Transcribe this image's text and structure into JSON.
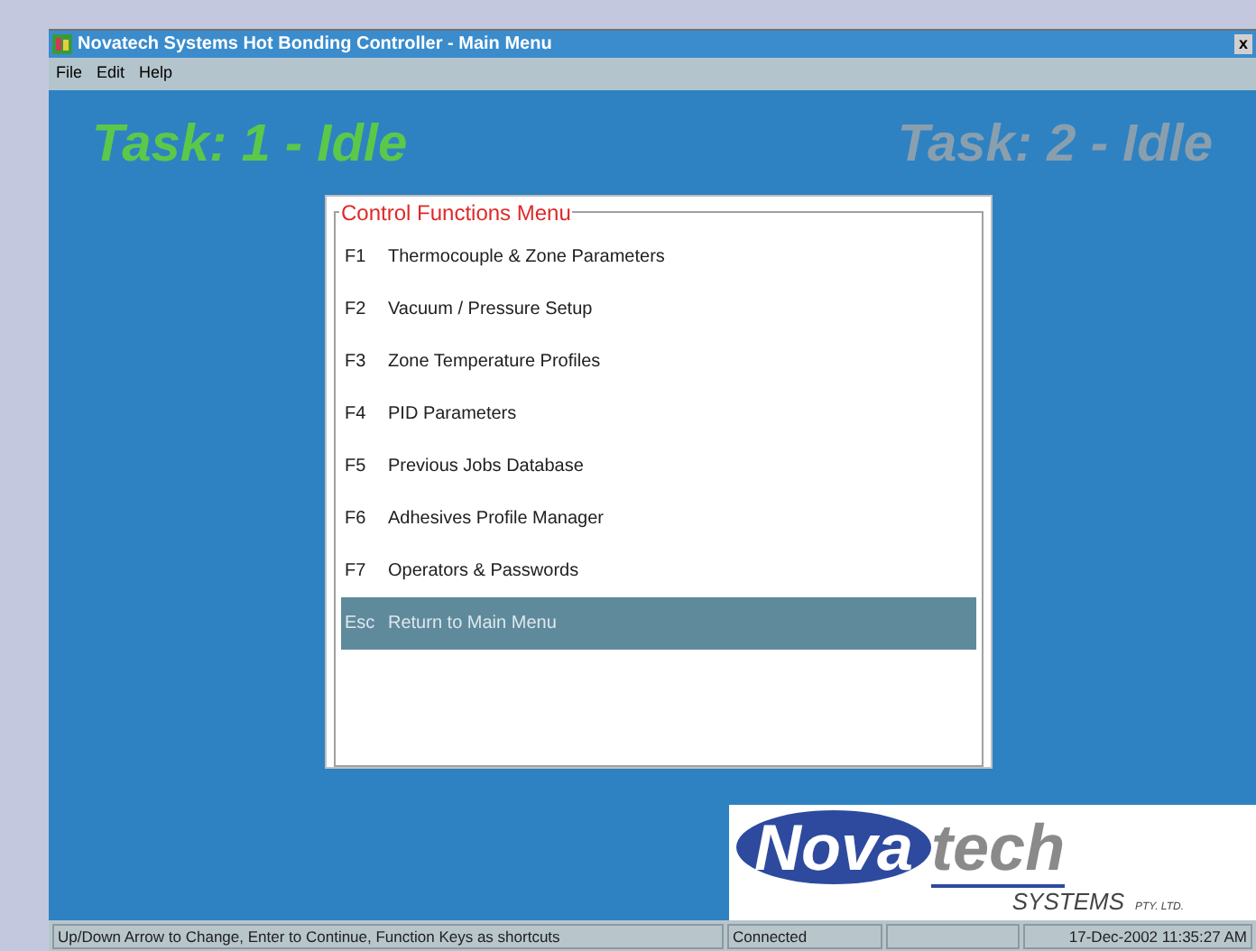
{
  "window": {
    "title": "Novatech Systems Hot Bonding Controller - Main Menu",
    "close": "x"
  },
  "menu": [
    {
      "label": "File"
    },
    {
      "label": "Edit"
    },
    {
      "label": "Help"
    }
  ],
  "tasks": [
    {
      "label": "Task: 1 - Idle",
      "active": true
    },
    {
      "label": "Task: 2 - Idle",
      "active": false
    }
  ],
  "control_menu": {
    "title": "Control Functions Menu",
    "items": [
      {
        "key": "F1",
        "label": "Thermocouple & Zone Parameters",
        "selected": false
      },
      {
        "key": "F2",
        "label": "Vacuum / Pressure Setup",
        "selected": false
      },
      {
        "key": "F3",
        "label": "Zone Temperature Profiles",
        "selected": false
      },
      {
        "key": "F4",
        "label": "PID Parameters",
        "selected": false
      },
      {
        "key": "F5",
        "label": "Previous Jobs Database",
        "selected": false
      },
      {
        "key": "F6",
        "label": "Adhesives Profile Manager",
        "selected": false
      },
      {
        "key": "F7",
        "label": "Operators & Passwords",
        "selected": false
      },
      {
        "key": "Esc",
        "label": "Return to Main Menu",
        "selected": true
      }
    ]
  },
  "logo": {
    "left": "Nova",
    "right": "tech",
    "sub": "SYSTEMS",
    "suffix": "PTY. LTD."
  },
  "status_bar": [
    "Up/Down Arrow to Change,  Enter to Continue,  Function Keys as shortcuts",
    "Connected",
    "17-Dec-2002   11:35:27 AM"
  ]
}
